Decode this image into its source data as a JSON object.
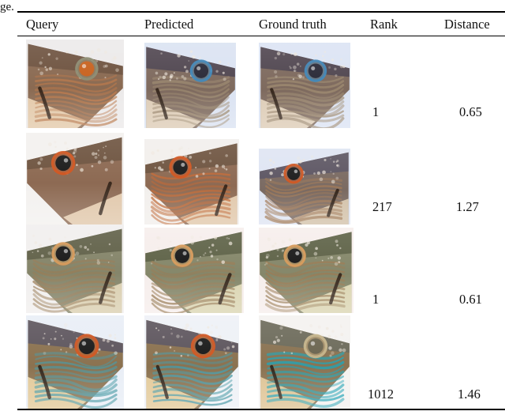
{
  "caption_tail": "ge.",
  "table": {
    "columns": [
      {
        "key": "query",
        "label": "Query"
      },
      {
        "key": "predicted",
        "label": "Predicted"
      },
      {
        "key": "groundtruth",
        "label": "Ground truth"
      },
      {
        "key": "rank",
        "label": "Rank"
      },
      {
        "key": "distance",
        "label": "Distance"
      }
    ],
    "rows": [
      {
        "rank": "1",
        "distance": "0.65",
        "query": {
          "alt": "fish-head-photo",
          "orient": "right",
          "bg": "#eceaea",
          "body": "#8a6a52",
          "belly": "#e8cfae",
          "stripe": "#b9784b",
          "iris": "#c8621f",
          "ring": "#8c8c72",
          "top": "#6c5340"
        },
        "predicted": {
          "alt": "fish-head-photo",
          "orient": "right",
          "bg": "#dbe3f2",
          "body": "#7e6a5e",
          "belly": "#e3d2bb",
          "stripe": "#9d8a70",
          "iris": "#2a2a38",
          "ring": "#3f87b8",
          "top": "#4d4450"
        },
        "groundtruth": {
          "alt": "fish-head-photo",
          "orient": "right",
          "bg": "#dce4f4",
          "body": "#7e6a5e",
          "belly": "#e3d2bb",
          "stripe": "#9d8a70",
          "iris": "#2a2a38",
          "ring": "#3f87b8",
          "top": "#4d4450"
        }
      },
      {
        "rank": "217",
        "distance": "1.27",
        "query": {
          "alt": "fish-head-photo",
          "orient": "left",
          "bg": "#f3f1ef",
          "body": "#8d6a53",
          "belly": "#e6cdb0",
          "stripe": "#c4estr",
          "iris": "#1d1d1d",
          "ring": "#d2551f",
          "top": "#6d5440"
        },
        "predicted": {
          "alt": "fish-head-photo",
          "orient": "left",
          "bg": "#f2efec",
          "body": "#8d6a53",
          "belly": "#e6cdb0",
          "stripe": "#c06a38",
          "iris": "#1d1d1d",
          "ring": "#d2551f",
          "top": "#6d5440"
        },
        "groundtruth": {
          "alt": "fish-head-photo",
          "orient": "left",
          "bg": "#dfe5f3",
          "body": "#7a6a62",
          "belly": "#d8c7ae",
          "stripe": "#a07a58",
          "iris": "#1d1d1d",
          "ring": "#d2551f",
          "top": "#5a5563"
        }
      },
      {
        "rank": "1",
        "distance": "0.61",
        "query": {
          "alt": "fish-head-photo",
          "orient": "left",
          "bg": "#f1efee",
          "body": "#85856a",
          "belly": "#ded3b4",
          "stripe": "#9a7c56",
          "iris": "#1a1a1a",
          "ring": "#d79a5a",
          "top": "#5f6048"
        },
        "predicted": {
          "alt": "fish-head-photo",
          "orient": "left",
          "bg": "#f6eeec",
          "body": "#85876a",
          "belly": "#dfd9b6",
          "stripe": "#9a7c56",
          "iris": "#1a1a1a",
          "ring": "#d79a5a",
          "top": "#5c5f45"
        },
        "groundtruth": {
          "alt": "fish-head-photo",
          "orient": "left",
          "bg": "#f6eeec",
          "body": "#85876a",
          "belly": "#dfd9b6",
          "stripe": "#9a7c56",
          "iris": "#1a1a1a",
          "ring": "#d79a5a",
          "top": "#5c5f45"
        }
      },
      {
        "rank": "1012",
        "distance": "1.46",
        "query": {
          "alt": "fish-head-photo",
          "orient": "right",
          "bg": "#e9eef6",
          "body": "#8b7250",
          "belly": "#e8cf9e",
          "stripe": "#4a9aa6",
          "iris": "#1b1b1b",
          "ring": "#d2551f",
          "top": "#5a5460"
        },
        "predicted": {
          "alt": "fish-head-photo",
          "orient": "right",
          "bg": "#eef1f6",
          "body": "#8b7250",
          "belly": "#e8cf9e",
          "stripe": "#4a9aa6",
          "iris": "#1b1b1b",
          "ring": "#d2551f",
          "top": "#5a5460"
        },
        "groundtruth": {
          "alt": "fish-head-photo",
          "orient": "right",
          "bg": "#f4f2f0",
          "body": "#8a7352",
          "belly": "#e3c899",
          "stripe": "#23a3b5",
          "iris": "#6b6550",
          "ring": "#c6b48a",
          "top": "#6a6a5c"
        }
      }
    ]
  }
}
